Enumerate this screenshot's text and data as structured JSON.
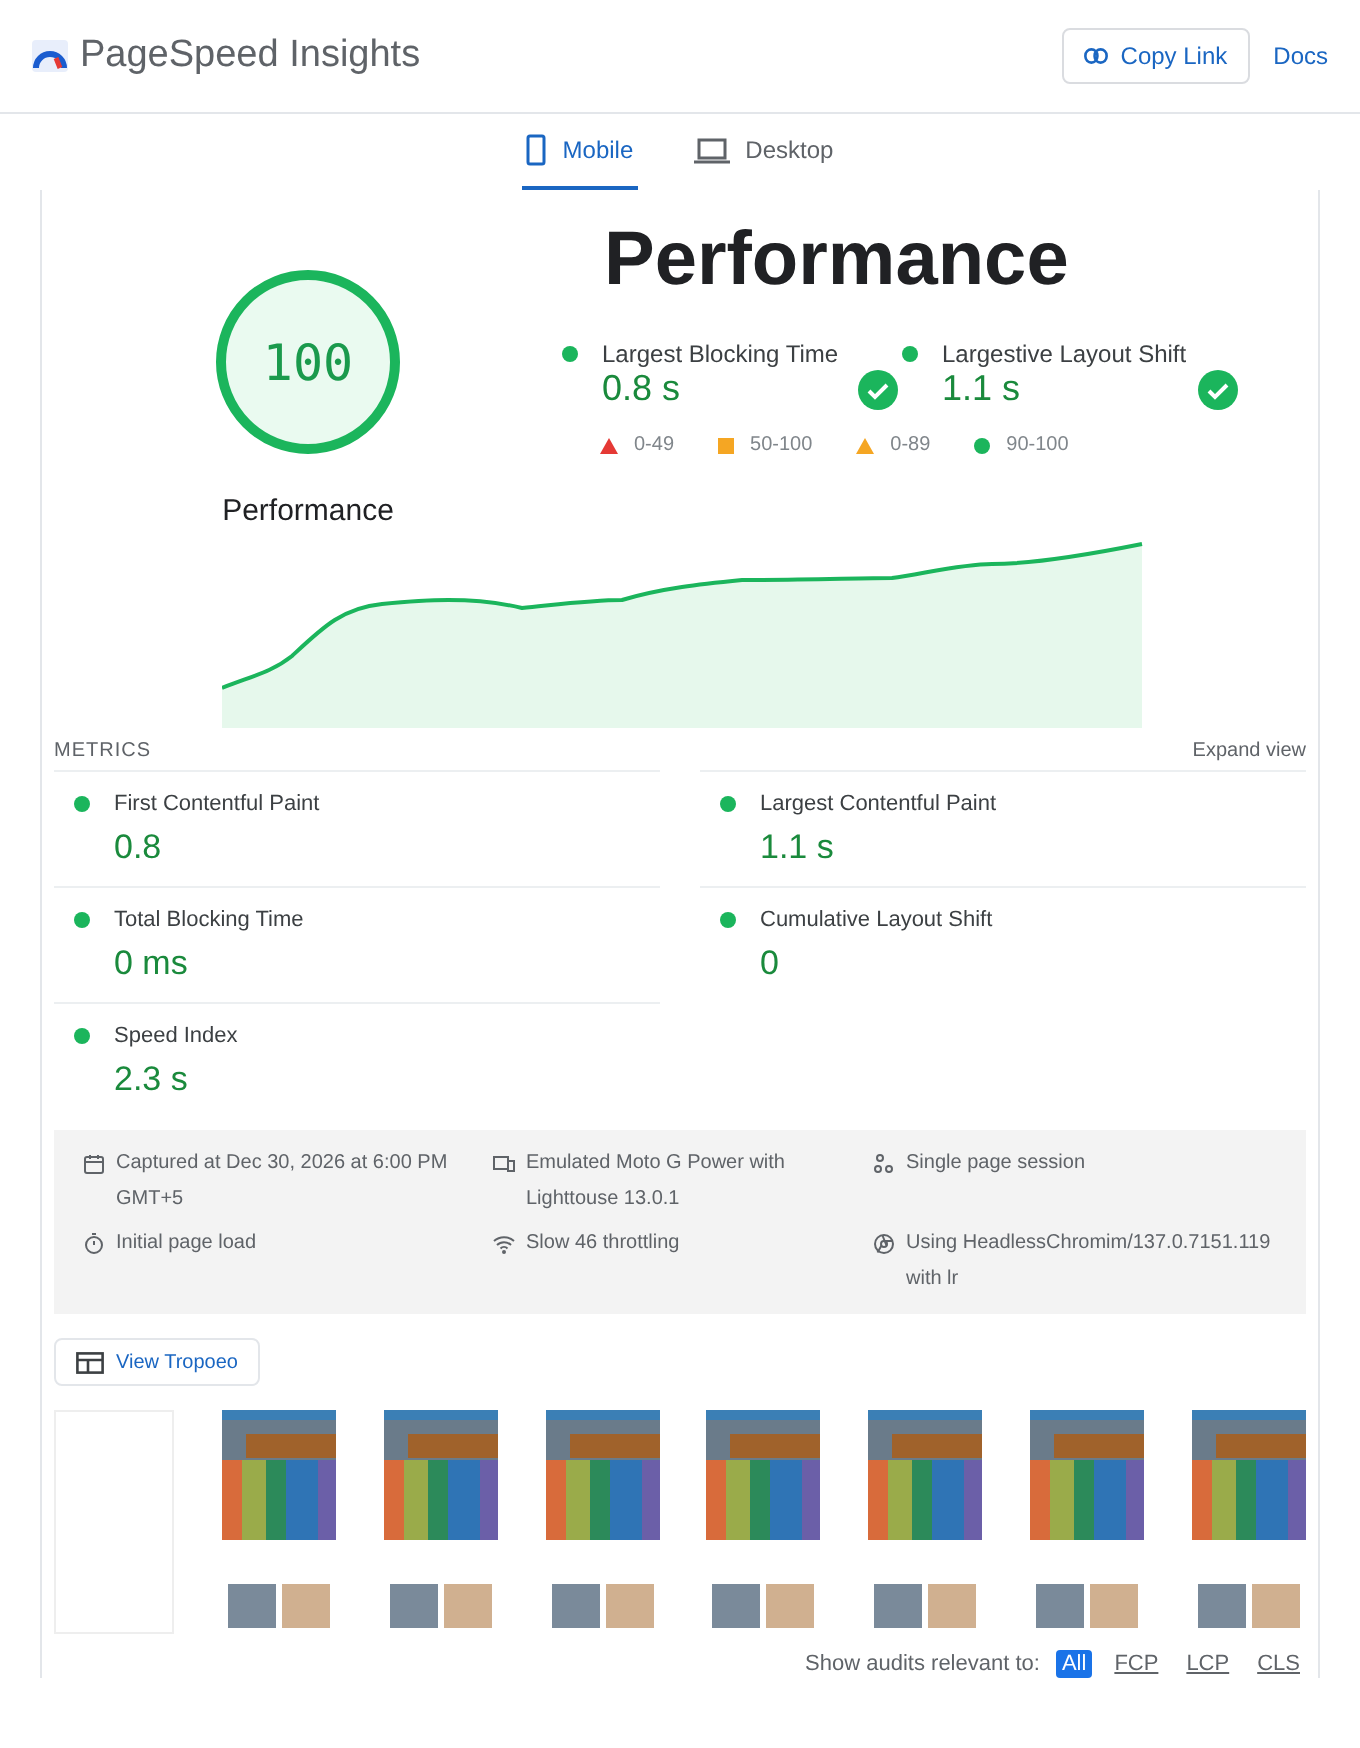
{
  "header": {
    "title": "PageSpeed Insights",
    "copy_link": "Copy Link",
    "docs": "Docs"
  },
  "tabs": [
    {
      "label": "Mobile",
      "kind": "phone",
      "selected": true
    },
    {
      "label": "Desktop",
      "kind": "laptop",
      "selected": false
    }
  ],
  "score": {
    "value": "100",
    "label": "Performance"
  },
  "heading": "Performance",
  "highlights": [
    {
      "label": "Largest Blocking Time",
      "value": "0.8 s",
      "passed": true
    },
    {
      "label": "Largestive Layout Shift",
      "value": "1.1 s",
      "passed": true
    }
  ],
  "legend": [
    {
      "kind": "triangle",
      "color": "#e53935",
      "range": "0-49"
    },
    {
      "kind": "square",
      "color": "#f5a623",
      "range": "50-100"
    },
    {
      "kind": "triangle",
      "color": "#f5a623",
      "range": "0-89"
    },
    {
      "kind": "circle",
      "color": "#1bb55c",
      "range": "90-100"
    }
  ],
  "metrics_section": {
    "title": "METRICS",
    "expand": "Expand view"
  },
  "metrics": [
    {
      "label": "First Contentful Paint",
      "value": "0.8",
      "color": "#1bb55c"
    },
    {
      "label": "Largest Contentful Paint",
      "value": "1.1 s",
      "color": "#1bb55c"
    },
    {
      "label": "Total Blocking Time",
      "value": "0 ms",
      "color": "#1bb55c"
    },
    {
      "label": "Cumulative Layout Shift",
      "value": "0",
      "color": "#1bb55c"
    },
    {
      "label": "Speed Index",
      "value": "2.3 s",
      "color": "#1bb55c"
    }
  ],
  "info": [
    {
      "kind": "calendar",
      "text": "Captured at Dec 30, 2026 at 6:00 PM GMT+5"
    },
    {
      "kind": "device",
      "text": "Emulated Moto G Power with Lighttouse 13.0.1"
    },
    {
      "kind": "session",
      "text": "Single page session"
    },
    {
      "kind": "timer",
      "text": "Initial page load"
    },
    {
      "kind": "wifi",
      "text": "Slow 46 throttling"
    },
    {
      "kind": "browser",
      "text": "Using HeadlessChromim/137.0.7151.119 with lr"
    }
  ],
  "treemap_button": "View Tropoeo",
  "filmstrip": [
    {
      "kind": "blank"
    },
    {
      "kind": "screenshot"
    },
    {
      "kind": "screenshot"
    },
    {
      "kind": "screenshot"
    },
    {
      "kind": "screenshot"
    },
    {
      "kind": "screenshot"
    },
    {
      "kind": "screenshot"
    },
    {
      "kind": "screenshot"
    }
  ],
  "audit_filter": {
    "label": "Show audits relevant to:",
    "options": [
      {
        "label": "All",
        "selected": true
      },
      {
        "label": "FCP",
        "selected": false
      },
      {
        "label": "LCP",
        "selected": false
      },
      {
        "label": "CLS",
        "selected": false
      }
    ]
  }
}
